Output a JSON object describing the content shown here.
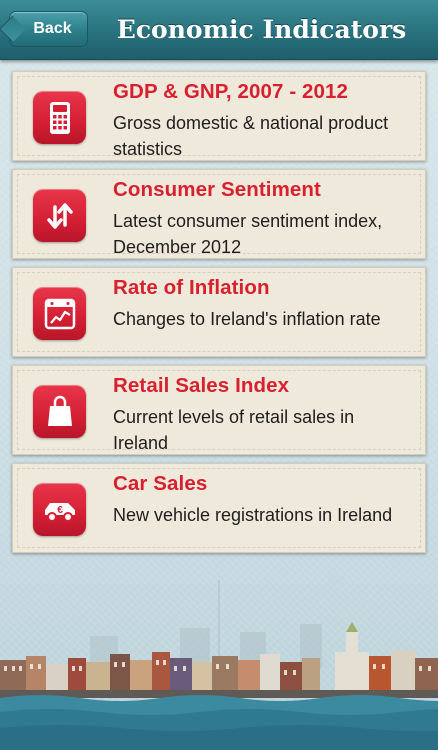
{
  "navbar": {
    "back_label": "Back",
    "title": "Economic Indicators"
  },
  "items": [
    {
      "title": "GDP & GNP, 2007 - 2012",
      "subtitle": "Gross domestic & national product statistics",
      "icon": "calculator-icon"
    },
    {
      "title": "Consumer Sentiment",
      "subtitle": "Latest consumer sentiment index, December 2012",
      "icon": "up-down-arrows-icon"
    },
    {
      "title": "Rate of Inflation",
      "subtitle": "Changes to Ireland's inflation rate",
      "icon": "calendar-chart-icon"
    },
    {
      "title": "Retail Sales Index",
      "subtitle": "Current levels of retail sales in Ireland",
      "icon": "shopping-bag-icon"
    },
    {
      "title": "Car Sales",
      "subtitle": "New vehicle registrations in Ireland",
      "icon": "euro-car-icon"
    }
  ],
  "colors": {
    "navbar": "#2a7480",
    "accent_red": "#d8202f",
    "card_bg": "#efe9dc",
    "text": "#1e1e1e"
  }
}
